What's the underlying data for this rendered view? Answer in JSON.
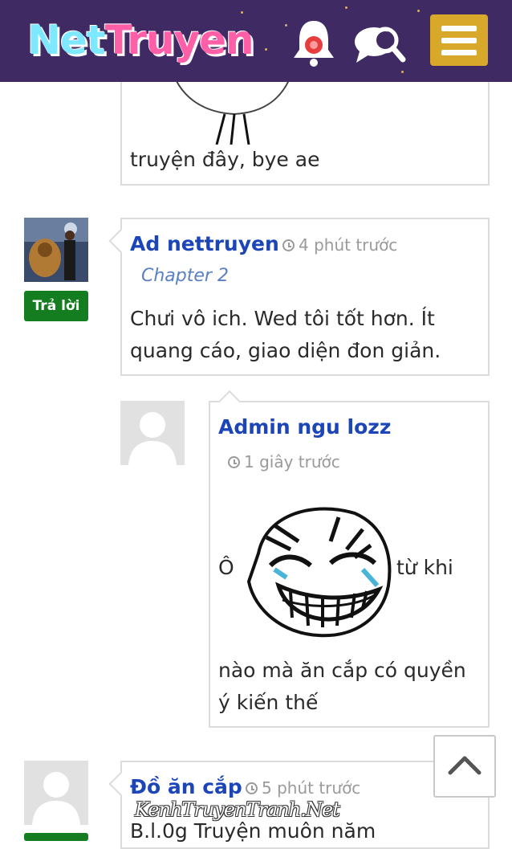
{
  "header": {
    "logo_part1": "Net",
    "logo_part2": "Truyen",
    "icons": [
      "bell-icon",
      "search-icon",
      "menu-icon"
    ],
    "colors": {
      "background": "#3f2a63",
      "menu_button": "#d7a82a"
    }
  },
  "comments": [
    {
      "text_lines": [
        "truyện đây, bye ae"
      ]
    },
    {
      "author": "Ad nettruyen",
      "time": "4 phút trước",
      "chapter": "Chapter 2",
      "text_lines": [
        "Chưi vô ich. Wed tôi tốt hơn. Ít",
        "quang cáo, giao diện đon giản."
      ],
      "reply_label": "Trả lời"
    },
    {
      "author": "Admin ngu lozz",
      "time": "1 giây trước",
      "text_before_image": "Ô",
      "text_after_image": "từ khi",
      "text_lines": [
        "nào mà ăn cắp có quyền",
        "ý kiến thế"
      ],
      "image": "laughing-meme-face"
    },
    {
      "author": "Đồ ăn cắp",
      "time": "5 phút trước",
      "text_lines": [
        "B.l.0g Truyện muôn năm"
      ]
    }
  ],
  "watermark": "KenhTruyenTranh.Net",
  "scroll_top": "chevron-up-icon",
  "colors": {
    "author": "#1c45b8",
    "reply_button": "#137d1f",
    "chapter": "#5a7fc4"
  }
}
